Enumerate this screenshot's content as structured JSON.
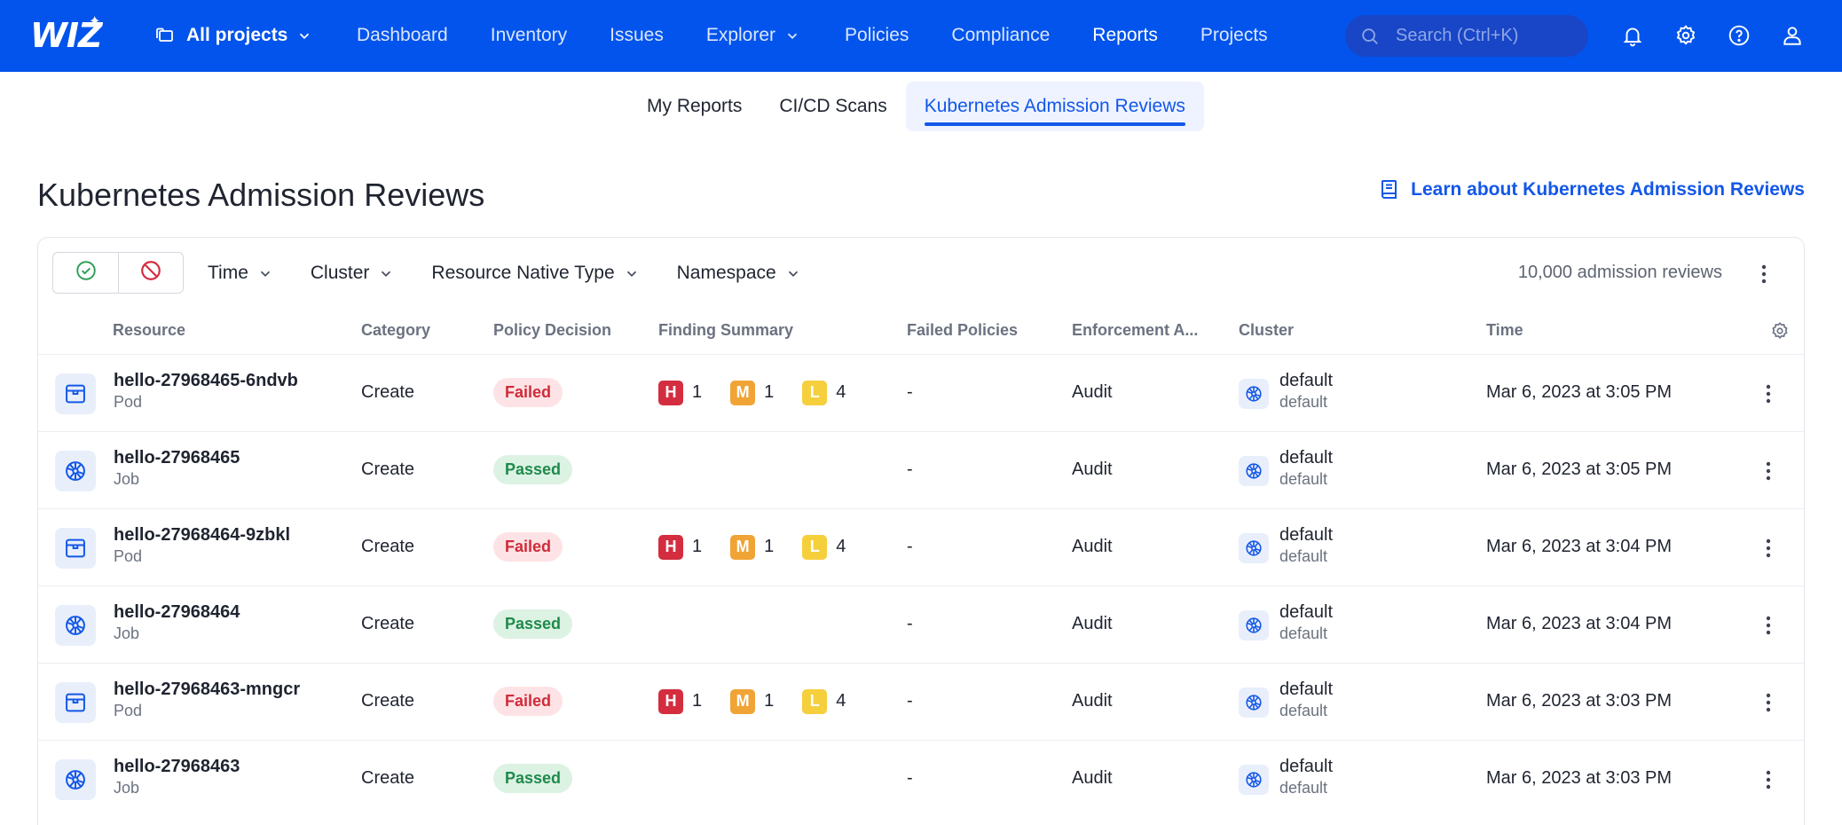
{
  "colors": {
    "brand": "#0254ec",
    "accent": "#1357e8",
    "failed": "#d02b3a",
    "passed": "#1f8a4c",
    "high": "#d42d3f",
    "medium": "#f0a435",
    "low": "#f6cf3c"
  },
  "nav": {
    "logo": "WIZ",
    "projects_label": "All projects",
    "links": [
      "Dashboard",
      "Inventory",
      "Issues",
      "Explorer",
      "Policies",
      "Compliance",
      "Reports",
      "Projects"
    ],
    "active_link": "Reports",
    "search_placeholder": "Search (Ctrl+K)",
    "icons": [
      "bell-icon",
      "gear-icon",
      "help-icon",
      "user-icon"
    ]
  },
  "subtabs": [
    "My Reports",
    "CI/CD Scans",
    "Kubernetes Admission Reviews"
  ],
  "active_subtab": "Kubernetes Admission Reviews",
  "page": {
    "title": "Kubernetes Admission Reviews",
    "learn_link": "Learn about Kubernetes Admission Reviews"
  },
  "toolbar": {
    "filters": [
      "Time",
      "Cluster",
      "Resource Native Type",
      "Namespace"
    ],
    "count": "10,000 admission reviews"
  },
  "table": {
    "headers": [
      "Resource",
      "Category",
      "Policy Decision",
      "Finding Summary",
      "Failed Policies",
      "Enforcement A...",
      "Cluster",
      "Time"
    ],
    "rows": [
      {
        "name": "hello-27968465-6ndvb",
        "type": "Pod",
        "icon": "pod-icon",
        "category": "Create",
        "decision": "Failed",
        "findings": {
          "h": "1",
          "m": "1",
          "l": "4"
        },
        "failed_policies": "-",
        "enforcement": "Audit",
        "cluster": "default",
        "cluster_sub": "default",
        "time": "Mar 6, 2023 at 3:05 PM"
      },
      {
        "name": "hello-27968465",
        "type": "Job",
        "icon": "kubernetes-icon",
        "category": "Create",
        "decision": "Passed",
        "findings": null,
        "failed_policies": "-",
        "enforcement": "Audit",
        "cluster": "default",
        "cluster_sub": "default",
        "time": "Mar 6, 2023 at 3:05 PM"
      },
      {
        "name": "hello-27968464-9zbkl",
        "type": "Pod",
        "icon": "pod-icon",
        "category": "Create",
        "decision": "Failed",
        "findings": {
          "h": "1",
          "m": "1",
          "l": "4"
        },
        "failed_policies": "-",
        "enforcement": "Audit",
        "cluster": "default",
        "cluster_sub": "default",
        "time": "Mar 6, 2023 at 3:04 PM"
      },
      {
        "name": "hello-27968464",
        "type": "Job",
        "icon": "kubernetes-icon",
        "category": "Create",
        "decision": "Passed",
        "findings": null,
        "failed_policies": "-",
        "enforcement": "Audit",
        "cluster": "default",
        "cluster_sub": "default",
        "time": "Mar 6, 2023 at 3:04 PM"
      },
      {
        "name": "hello-27968463-mngcr",
        "type": "Pod",
        "icon": "pod-icon",
        "category": "Create",
        "decision": "Failed",
        "findings": {
          "h": "1",
          "m": "1",
          "l": "4"
        },
        "failed_policies": "-",
        "enforcement": "Audit",
        "cluster": "default",
        "cluster_sub": "default",
        "time": "Mar 6, 2023 at 3:03 PM"
      },
      {
        "name": "hello-27968463",
        "type": "Job",
        "icon": "kubernetes-icon",
        "category": "Create",
        "decision": "Passed",
        "findings": null,
        "failed_policies": "-",
        "enforcement": "Audit",
        "cluster": "default",
        "cluster_sub": "default",
        "time": "Mar 6, 2023 at 3:03 PM"
      }
    ]
  }
}
